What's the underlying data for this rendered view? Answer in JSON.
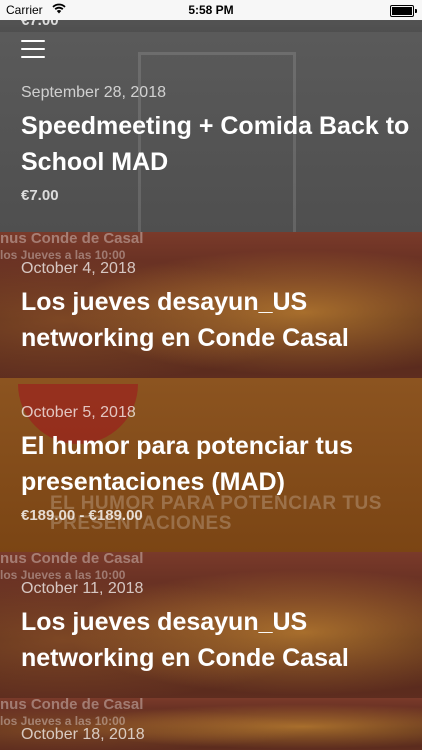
{
  "status_bar": {
    "carrier": "Carrier",
    "time": "5:58 PM"
  },
  "top_partial_price": "€7.00",
  "events": [
    {
      "date": "September 28, 2018",
      "title": "Speedmeeting + Comida Back to School MAD",
      "price": "€7.00"
    },
    {
      "date": "October 4, 2018",
      "title": "Los jueves desayun_US networking en Conde Casal",
      "price": ""
    },
    {
      "date": "October 5, 2018",
      "title": "El humor para potenciar tus presentaciones (MAD)",
      "price": "€189.00 - €189.00"
    },
    {
      "date": "October 11, 2018",
      "title": "Los jueves desayun_US networking en Conde Casal",
      "price": ""
    },
    {
      "date": "October 18, 2018",
      "title": "",
      "price": ""
    }
  ],
  "image_text": {
    "venue_banner": "nus Conde de Casal",
    "venue_sub": "los  Jueves a las 10:00",
    "promo_overlay": "EL HUMOR PARA POTENCIAR TUS PRESENTACIONES"
  }
}
